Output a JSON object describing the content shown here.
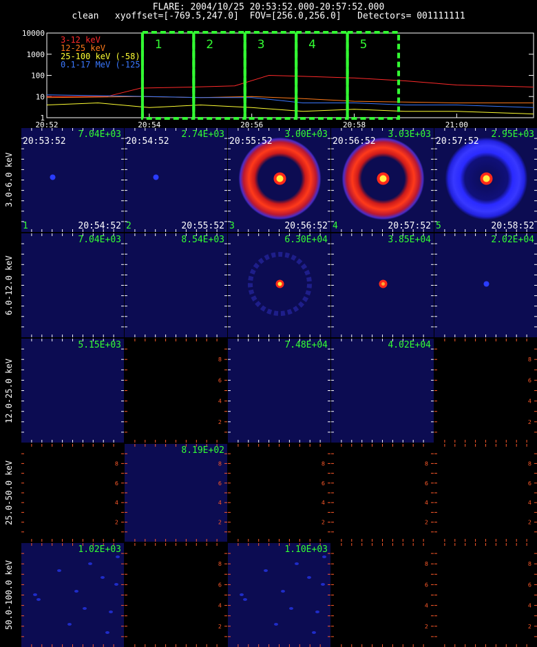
{
  "header": {
    "line1": "FLARE: 2004/10/25 20:53:52.000-20:57:52.000",
    "line2": "clean   xyoffset=[-769.5,247.0]  FOV=[256.0,256.0]   Detectors= 001111111"
  },
  "lightcurve": {
    "y_ticks": [
      "10000",
      "1000",
      "100",
      "10",
      "1"
    ],
    "x_ticks": [
      "20:52",
      "20:54",
      "20:56",
      "20:58",
      "21:00"
    ],
    "legend": [
      {
        "label": "3-12 keV",
        "color": "#ff2a2a"
      },
      {
        "label": "12-25 keV",
        "color": "#ff7a1a"
      },
      {
        "label": "25-100 keV (-58)",
        "color": "#ffff33"
      },
      {
        "label": "0.1-17 MeV (-125)",
        "color": "#3a78ff"
      }
    ],
    "intervals": [
      "1",
      "2",
      "3",
      "4",
      "5"
    ],
    "interval_color": "#33ff33"
  },
  "chart_data": {
    "type": "line",
    "title": "",
    "ylog": true,
    "ylim": [
      1,
      10000
    ],
    "x_ticks": [
      "20:52",
      "20:54",
      "20:56",
      "20:58",
      "21:00"
    ],
    "xlim": [
      "20:52",
      "21:01:30"
    ],
    "interval_bounds": [
      "20:53:52",
      "20:54:52",
      "20:55:52",
      "20:56:52",
      "20:57:52",
      "20:58:52"
    ],
    "series": [
      {
        "name": "3-12 keV",
        "points": [
          [
            "20:52",
            10
          ],
          [
            "20:53:10",
            10
          ],
          [
            "20:53:50",
            25
          ],
          [
            "20:54:50",
            28
          ],
          [
            "20:55:40",
            32
          ],
          [
            "20:56:20",
            100
          ],
          [
            "20:57:00",
            90
          ],
          [
            "20:58:00",
            75
          ],
          [
            "20:59:00",
            55
          ],
          [
            "21:00:00",
            35
          ],
          [
            "21:01:30",
            28
          ]
        ]
      },
      {
        "name": "12-25 keV",
        "points": [
          [
            "20:52",
            9
          ],
          [
            "20:53:50",
            10
          ],
          [
            "20:55:00",
            9
          ],
          [
            "20:56:00",
            10
          ],
          [
            "20:57:00",
            8
          ],
          [
            "20:58:00",
            6
          ],
          [
            "21:00:00",
            5
          ],
          [
            "21:01:30",
            5
          ]
        ]
      },
      {
        "name": "25-100 keV (-58)",
        "points": [
          [
            "20:52",
            4
          ],
          [
            "20:53",
            5
          ],
          [
            "20:54",
            3
          ],
          [
            "20:55",
            4
          ],
          [
            "20:56",
            3
          ],
          [
            "20:57",
            2
          ],
          [
            "20:58",
            2.5
          ],
          [
            "20:59",
            2
          ],
          [
            "21:00",
            2
          ],
          [
            "21:01:30",
            1.5
          ]
        ]
      },
      {
        "name": "0.1-17 MeV (-125)",
        "points": [
          [
            "20:52",
            12
          ],
          [
            "20:53",
            11
          ],
          [
            "20:54",
            10
          ],
          [
            "20:55",
            9
          ],
          [
            "20:56",
            9
          ],
          [
            "20:57",
            5
          ],
          [
            "20:58",
            5
          ],
          [
            "20:59",
            4
          ],
          [
            "21:00",
            4
          ],
          [
            "21:01:30",
            3
          ]
        ]
      }
    ]
  },
  "grid": {
    "rows": [
      "3.0-6.0 keV",
      "6.0-12.0 keV",
      "12.0-25.0 keV",
      "25.0-50.0 keV",
      "50.0-100.0 keV"
    ],
    "time_starts": [
      "20:53:52",
      "20:54:52",
      "20:55:52",
      "20:56:52",
      "20:57:52"
    ],
    "time_ends": [
      "20:54:52",
      "20:55:52",
      "20:56:52",
      "20:57:52",
      "20:58:52"
    ],
    "panel_index": [
      "1",
      "2",
      "3",
      "4",
      "5"
    ],
    "axis_ticks": [
      "2",
      "4",
      "6",
      "8"
    ],
    "panels": [
      [
        {
          "value": "7.04E+03",
          "image": "dot"
        },
        {
          "value": "2.74E+03",
          "image": "dot"
        },
        {
          "value": "3.00E+03",
          "image": "ring"
        },
        {
          "value": "3.03E+03",
          "image": "ring"
        },
        {
          "value": "2.95E+03",
          "image": "bluering"
        }
      ],
      [
        {
          "value": "7.04E+03",
          "image": "blank"
        },
        {
          "value": "8.54E+03",
          "image": "blank"
        },
        {
          "value": "6.30E+04",
          "image": "faintring"
        },
        {
          "value": "3.85E+04",
          "image": "smalldot"
        },
        {
          "value": "2.02E+04",
          "image": "bluedot"
        }
      ],
      [
        {
          "value": "5.15E+03",
          "image": "blank"
        },
        {
          "value": "",
          "image": "black"
        },
        {
          "value": "7.48E+04",
          "image": "blank"
        },
        {
          "value": "4.02E+04",
          "image": "blank"
        },
        {
          "value": "",
          "image": "black"
        }
      ],
      [
        {
          "value": "",
          "image": "black"
        },
        {
          "value": "8.19E+02",
          "image": "blank"
        },
        {
          "value": "",
          "image": "black"
        },
        {
          "value": "",
          "image": "black"
        },
        {
          "value": "",
          "image": "black"
        }
      ],
      [
        {
          "value": "1.02E+03",
          "image": "speckle"
        },
        {
          "value": "",
          "image": "black"
        },
        {
          "value": "1.10E+03",
          "image": "speckle"
        },
        {
          "value": "",
          "image": "black"
        },
        {
          "value": "",
          "image": "black"
        }
      ]
    ]
  }
}
